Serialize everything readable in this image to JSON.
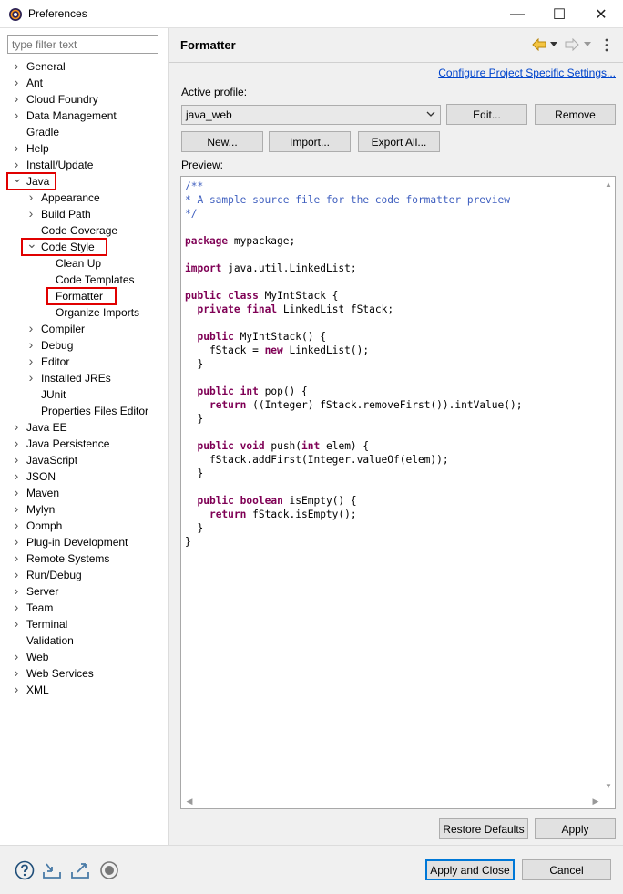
{
  "window": {
    "title": "Preferences",
    "minimize_icon": "—",
    "maximize_icon": "☐",
    "close_icon": "✕"
  },
  "filter": {
    "placeholder": "type filter text"
  },
  "tree": [
    {
      "label": "General",
      "level": 0,
      "expandable": true,
      "expanded": false
    },
    {
      "label": "Ant",
      "level": 0,
      "expandable": true,
      "expanded": false
    },
    {
      "label": "Cloud Foundry",
      "level": 0,
      "expandable": true,
      "expanded": false
    },
    {
      "label": "Data Management",
      "level": 0,
      "expandable": true,
      "expanded": false
    },
    {
      "label": "Gradle",
      "level": 0,
      "expandable": false,
      "expanded": false
    },
    {
      "label": "Help",
      "level": 0,
      "expandable": true,
      "expanded": false
    },
    {
      "label": "Install/Update",
      "level": 0,
      "expandable": true,
      "expanded": false
    },
    {
      "label": "Java",
      "level": 0,
      "expandable": true,
      "expanded": true,
      "highlight": true
    },
    {
      "label": "Appearance",
      "level": 1,
      "expandable": true,
      "expanded": false
    },
    {
      "label": "Build Path",
      "level": 1,
      "expandable": true,
      "expanded": false
    },
    {
      "label": "Code Coverage",
      "level": 1,
      "expandable": false,
      "expanded": false
    },
    {
      "label": "Code Style",
      "level": 1,
      "expandable": true,
      "expanded": true,
      "highlight": true
    },
    {
      "label": "Clean Up",
      "level": 2,
      "expandable": false,
      "expanded": false
    },
    {
      "label": "Code Templates",
      "level": 2,
      "expandable": false,
      "expanded": false
    },
    {
      "label": "Formatter",
      "level": 2,
      "expandable": false,
      "expanded": false,
      "highlight": true,
      "selected": true
    },
    {
      "label": "Organize Imports",
      "level": 2,
      "expandable": false,
      "expanded": false
    },
    {
      "label": "Compiler",
      "level": 1,
      "expandable": true,
      "expanded": false
    },
    {
      "label": "Debug",
      "level": 1,
      "expandable": true,
      "expanded": false
    },
    {
      "label": "Editor",
      "level": 1,
      "expandable": true,
      "expanded": false
    },
    {
      "label": "Installed JREs",
      "level": 1,
      "expandable": true,
      "expanded": false
    },
    {
      "label": "JUnit",
      "level": 1,
      "expandable": false,
      "expanded": false
    },
    {
      "label": "Properties Files Editor",
      "level": 1,
      "expandable": false,
      "expanded": false
    },
    {
      "label": "Java EE",
      "level": 0,
      "expandable": true,
      "expanded": false
    },
    {
      "label": "Java Persistence",
      "level": 0,
      "expandable": true,
      "expanded": false
    },
    {
      "label": "JavaScript",
      "level": 0,
      "expandable": true,
      "expanded": false
    },
    {
      "label": "JSON",
      "level": 0,
      "expandable": true,
      "expanded": false
    },
    {
      "label": "Maven",
      "level": 0,
      "expandable": true,
      "expanded": false
    },
    {
      "label": "Mylyn",
      "level": 0,
      "expandable": true,
      "expanded": false
    },
    {
      "label": "Oomph",
      "level": 0,
      "expandable": true,
      "expanded": false
    },
    {
      "label": "Plug-in Development",
      "level": 0,
      "expandable": true,
      "expanded": false
    },
    {
      "label": "Remote Systems",
      "level": 0,
      "expandable": true,
      "expanded": false
    },
    {
      "label": "Run/Debug",
      "level": 0,
      "expandable": true,
      "expanded": false
    },
    {
      "label": "Server",
      "level": 0,
      "expandable": true,
      "expanded": false
    },
    {
      "label": "Team",
      "level": 0,
      "expandable": true,
      "expanded": false
    },
    {
      "label": "Terminal",
      "level": 0,
      "expandable": true,
      "expanded": false
    },
    {
      "label": "Validation",
      "level": 0,
      "expandable": false,
      "expanded": false
    },
    {
      "label": "Web",
      "level": 0,
      "expandable": true,
      "expanded": false
    },
    {
      "label": "Web Services",
      "level": 0,
      "expandable": true,
      "expanded": false
    },
    {
      "label": "XML",
      "level": 0,
      "expandable": true,
      "expanded": false
    }
  ],
  "page": {
    "title": "Formatter",
    "configure_link": "Configure Project Specific Settings...",
    "active_profile_label": "Active profile:",
    "profile_value": "java_web",
    "edit_button": "Edit...",
    "remove_button": "Remove",
    "new_button": "New...",
    "import_button": "Import...",
    "export_button": "Export All...",
    "preview_label": "Preview:",
    "restore_defaults_button": "Restore Defaults",
    "apply_button": "Apply"
  },
  "code": [
    [
      [
        "c",
        "/**"
      ]
    ],
    [
      [
        "c",
        "* A sample source file for the code formatter preview"
      ]
    ],
    [
      [
        "c",
        "*/"
      ]
    ],
    [],
    [
      [
        "k",
        "package"
      ],
      [
        "t",
        " mypackage;"
      ]
    ],
    [],
    [
      [
        "k",
        "import"
      ],
      [
        "t",
        " java.util.LinkedList;"
      ]
    ],
    [],
    [
      [
        "k",
        "public"
      ],
      [
        "t",
        " "
      ],
      [
        "k",
        "class"
      ],
      [
        "t",
        " MyIntStack {"
      ]
    ],
    [
      [
        "t",
        "  "
      ],
      [
        "k",
        "private"
      ],
      [
        "t",
        " "
      ],
      [
        "k",
        "final"
      ],
      [
        "t",
        " LinkedList fStack;"
      ]
    ],
    [],
    [
      [
        "t",
        "  "
      ],
      [
        "k",
        "public"
      ],
      [
        "t",
        " MyIntStack() {"
      ]
    ],
    [
      [
        "t",
        "    fStack = "
      ],
      [
        "k",
        "new"
      ],
      [
        "t",
        " LinkedList();"
      ]
    ],
    [
      [
        "t",
        "  }"
      ]
    ],
    [],
    [
      [
        "t",
        "  "
      ],
      [
        "k",
        "public"
      ],
      [
        "t",
        " "
      ],
      [
        "k",
        "int"
      ],
      [
        "t",
        " pop() {"
      ]
    ],
    [
      [
        "t",
        "    "
      ],
      [
        "k",
        "return"
      ],
      [
        "t",
        " ((Integer) fStack.removeFirst()).intValue();"
      ]
    ],
    [
      [
        "t",
        "  }"
      ]
    ],
    [],
    [
      [
        "t",
        "  "
      ],
      [
        "k",
        "public"
      ],
      [
        "t",
        " "
      ],
      [
        "k",
        "void"
      ],
      [
        "t",
        " push("
      ],
      [
        "k",
        "int"
      ],
      [
        "t",
        " elem) {"
      ]
    ],
    [
      [
        "t",
        "    fStack.addFirst(Integer.valueOf(elem));"
      ]
    ],
    [
      [
        "t",
        "  }"
      ]
    ],
    [],
    [
      [
        "t",
        "  "
      ],
      [
        "k",
        "public"
      ],
      [
        "t",
        " "
      ],
      [
        "k",
        "boolean"
      ],
      [
        "t",
        " isEmpty() {"
      ]
    ],
    [
      [
        "t",
        "    "
      ],
      [
        "k",
        "return"
      ],
      [
        "t",
        " fStack.isEmpty();"
      ]
    ],
    [
      [
        "t",
        "  }"
      ]
    ],
    [
      [
        "t",
        "}"
      ]
    ]
  ],
  "footer": {
    "apply_close_button": "Apply and Close",
    "cancel_button": "Cancel"
  },
  "colors": {
    "highlight_box": "#e00000",
    "link": "#0044cc",
    "keyword": "#7f0055",
    "comment": "#3f5fbf",
    "default_button_border": "#0078d7"
  }
}
